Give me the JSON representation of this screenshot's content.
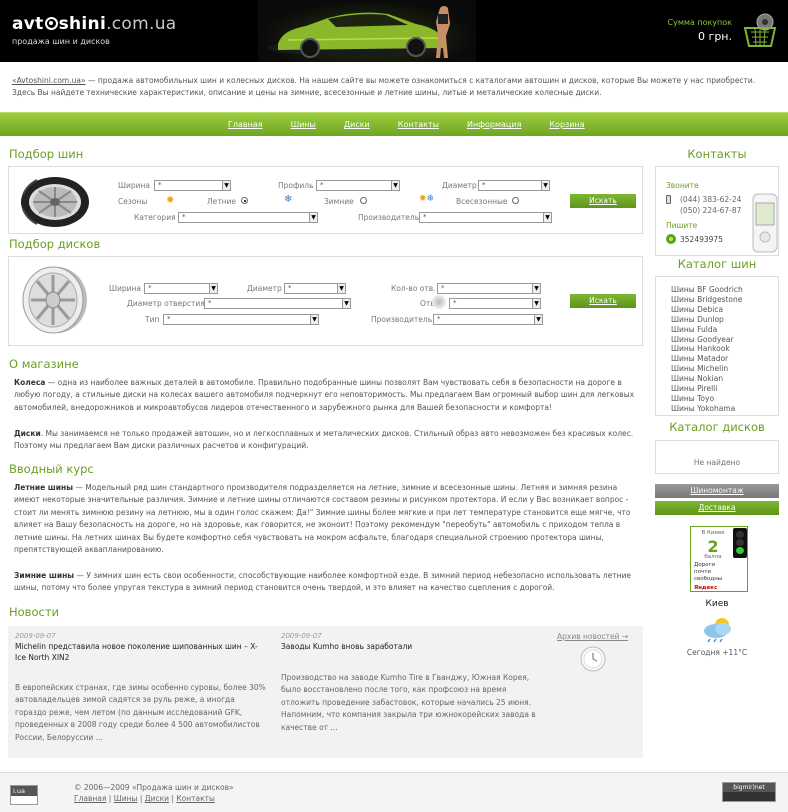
{
  "header": {
    "logo_main": "avt",
    "logo_mid": "shini",
    "logo_domain": ".com.ua",
    "tagline": "продажа шин и дисков",
    "cart_label": "Сумма покупок",
    "cart_total": "0 грн."
  },
  "intro": {
    "link": "«Avtoshini.com.ua»",
    "text": " — продажа автомобильных шин и колесных дисков. На нашем сайте вы можете ознакомиться с каталогами автошин и дисков, которые Вы можете у нас приобрести. Здесь Вы найдете технические характеристики, описание и цены на зимние, всесезонные и летние шины, литые и металические колесные диски."
  },
  "nav": [
    "Главная",
    "Шины",
    "Диски",
    "Контакты",
    "Информация",
    "Корзина"
  ],
  "tyre_search": {
    "title": "Подбор шин",
    "width_label": "Ширина",
    "profile_label": "Профиль",
    "diameter_label": "Диаметр",
    "seasons_label": "Сезоны",
    "summer_label": "Летние",
    "winter_label": "Зимние",
    "allseason_label": "Всесезонные",
    "category_label": "Категория",
    "maker_label": "Производитель",
    "select_value": "*",
    "button": "Искать"
  },
  "disc_search": {
    "title": "Подбор дисков",
    "width_label": "Ширина",
    "diameter_label": "Диаметр",
    "holes_label": "Кол-во отв.",
    "hole_diam_label": "Диаметр отверстия",
    "offset_label": "Отв",
    "type_label": "Тип",
    "maker_label": "Производитель",
    "select_value": "*",
    "button": "Искать"
  },
  "about": {
    "title": "О магазине",
    "p1_bold": "Колеса",
    "p1": " — одна из наиболее важных деталей в автомобиле. Правильно подобранные шины позволят Вам чувствовать себя в безопасности на дороге в любую погоду, а стильные диски на колесах вашего автомобиля подчеркнут его неповторимость. Мы предлагаем Вам огромный выбор шин для легковых автомобилей, внедорожников и микроавтобусов лидеров отечественного и зарубежного рынка для Вашей безопасности и комфорта!",
    "p2_bold": "Диски",
    "p2": ". Мы занимаемся не только продажей автошин, но и легкосплавных и металических дисков. Стильный образ авто невозможен без красивых колес. Поэтому мы предлагаем Вам диски различных расчетов и конфигураций."
  },
  "course": {
    "title": "Вводный курс",
    "p1_bold": "Летние шины",
    "p1": " — Модельный ряд шин стандартного производителя подразделяется на летние, зимние и всесезонные шины. Летняя и зимняя резина имеют некоторые значительные различия. Зимние и летние шины отличаются составом резины и рисунком протектора. И если у Вас возникает вопрос - стоит ли менять зимнюю резину на летнюю, мы в один голос скажем: Да!\" Зимние шины более мягкие и при лет температуре становится еще мягче, что влияет на Вашу безопасность на дороге, но на здоровье, как говорится, не эконоит! Поэтому рекомендум \"переобуть\" автомобиль с приходом тепла в летние шины. На летних шинах Вы будете комфортно себя чувствовать на мокром асфальте, благодаря специальной строению протектора шины, препятствующей аквапланированию.",
    "p2_bold": "Зимние шины",
    "p2": " — У зимних шин есть свои особенности, способствующие наиболее комфортной езде. В зимний период небезопасно использовать летние шины, потому что более упругая текстура в зимний период становится очень твердой, и это влияет на качество сцепления с дорогой."
  },
  "news": {
    "title": "Новости",
    "archive": "Архив новостей →",
    "items": [
      {
        "date": "2009-09-07",
        "title": "Michelin представила новое поколение шипованных шин – X-Ice North XIN2",
        "text": "В европейских странах, где зимы особенно суровы, более 30% автовладельцев зимой садятся за руль реже, а иногда гораздо реже, чем летом (по данным исследований GFK, проведенных в 2008 году среди более 4 500 автомобилистов России, Белоруссии ..."
      },
      {
        "date": "2009-09-07",
        "title": "Заводы Kumho вновь заработали",
        "text": "Производство на заводе Kumho Tire в Гванджу, Южная Корея, было восстановлено после того, как профсоюз на время отложить проведение забастовок, которые начались 25 июня. Напомним, что компания закрыла три южнокорейских завода в качестве от ..."
      }
    ]
  },
  "contacts": {
    "title": "Контакты",
    "call_label": "Звоните",
    "phone1": "(044) 383-62-24",
    "phone2": "(050) 224-67-87",
    "write_label": "Пишите",
    "icq": "352493975"
  },
  "tyre_catalog": {
    "title": "Каталог шин",
    "items": [
      "Шины BF Goodrich",
      "Шины Bridgestone",
      "Шины Debica",
      "Шины Dunlop",
      "Шины Fulda",
      "Шины Goodyear",
      "Шины Hankook",
      "Шины Matador",
      "Шины Michelin",
      "Шины Nokian",
      "Шины Pirelli",
      "Шины Toyo",
      "Шины Yokohama"
    ]
  },
  "disc_catalog": {
    "title": "Каталог дисков",
    "empty": "Не найдено"
  },
  "side_buttons": {
    "fitting": "Шиномонтаж",
    "delivery": "Доставка"
  },
  "traffic": {
    "city_top": "В Киеве",
    "score": "2",
    "score_word": "балла",
    "desc": "Дороги почти свободны",
    "brand": "Яндекс"
  },
  "weather": {
    "city": "Киев",
    "today": "Сегодня +11°С"
  },
  "footer": {
    "copyright": "© 2006—2009 «Продажа шин и дисков»",
    "links": [
      "Главная",
      "Шины",
      "Диски",
      "Контакты"
    ],
    "counter_left": "i.ua",
    "counter_right": "bigmir)net"
  },
  "colors": {
    "accent": "#6aa022",
    "nav_bar": "#86bb30",
    "header_bg": "#000000"
  }
}
